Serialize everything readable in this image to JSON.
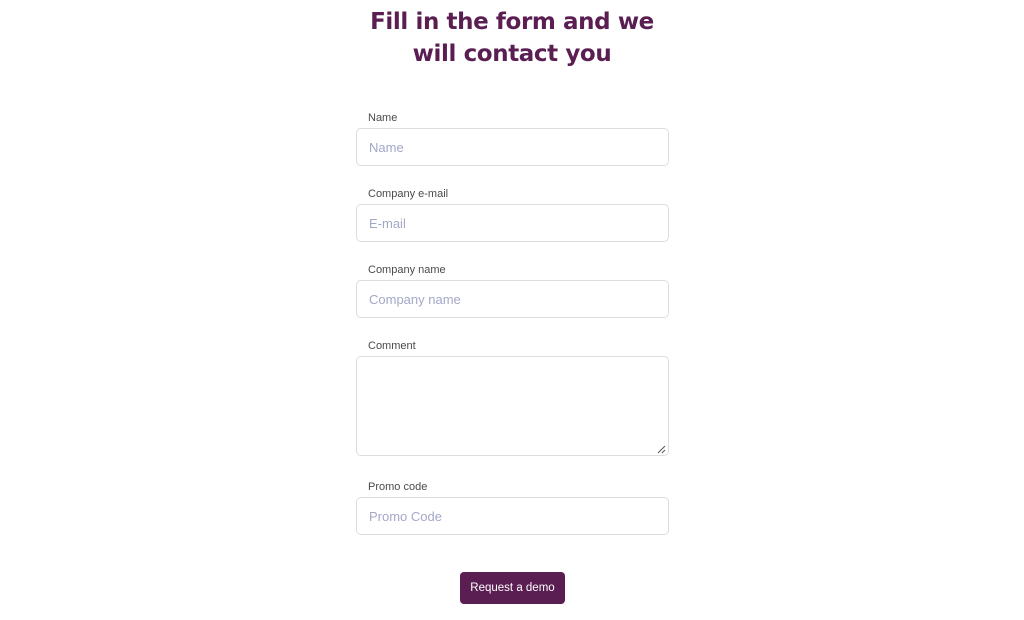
{
  "header": {
    "title_line1": "Fill in the form and we",
    "title_line2": "will contact you"
  },
  "form": {
    "name": {
      "label": "Name",
      "placeholder": "Name",
      "value": ""
    },
    "email": {
      "label": "Company e-mail",
      "placeholder": "E-mail",
      "value": ""
    },
    "company": {
      "label": "Company name",
      "placeholder": "Company name",
      "value": ""
    },
    "comment": {
      "label": "Comment",
      "value": ""
    },
    "promo": {
      "label": "Promo code",
      "placeholder": "Promo Code",
      "value": ""
    },
    "submit_label": "Request a demo"
  },
  "colors": {
    "brand": "#5a1e52",
    "input_border": "#dcdde3",
    "placeholder": "#a3a8c7",
    "label": "#4a4a4a"
  },
  "icons": {
    "textarea_resize": "resize-grip-icon"
  }
}
